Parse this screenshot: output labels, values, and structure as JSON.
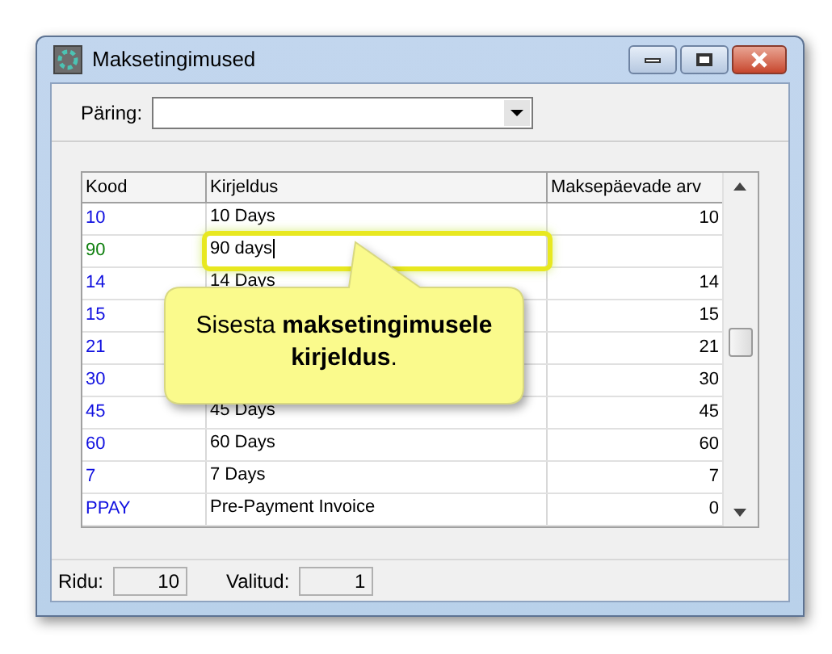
{
  "window": {
    "title": "Maksetingimused"
  },
  "query": {
    "label": "Päring:"
  },
  "table": {
    "columns": [
      "Kood",
      "Kirjeldus",
      "Maksepäevade arv"
    ],
    "rows": [
      {
        "code": "10",
        "description": "10 Days",
        "days": "10",
        "editing": false
      },
      {
        "code": "90",
        "description": "90 days",
        "editing": true
      },
      {
        "code": "14",
        "description": "14 Days",
        "days": "14",
        "editing": false
      },
      {
        "code": "15",
        "days": "15",
        "editing": false
      },
      {
        "code": "21",
        "days": "21",
        "editing": false
      },
      {
        "code": "30",
        "days": "30",
        "editing": false
      },
      {
        "code": "45",
        "description": "45 Days",
        "days": "45",
        "editing": false
      },
      {
        "code": "60",
        "description": "60 Days",
        "days": "60",
        "editing": false
      },
      {
        "code": "7",
        "description": "7 Days",
        "days": "7",
        "editing": false
      },
      {
        "code": "PPAY",
        "description": "Pre-Payment Invoice",
        "days": "0",
        "editing": false
      }
    ]
  },
  "callout": {
    "text": "Sisesta **maksetingimusele kirjeldus**."
  },
  "status_bar": {
    "rows_label": "Ridu:",
    "rows_value": "10",
    "selected_label": "Valitud:",
    "selected_value": "1"
  }
}
